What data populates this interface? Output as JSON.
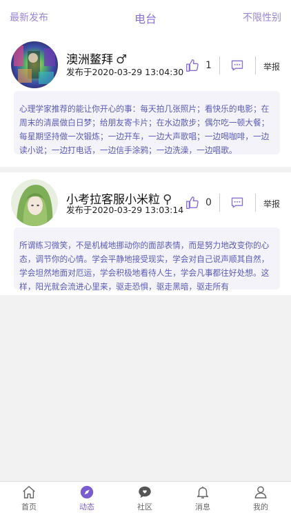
{
  "header": {
    "left_label": "最新发布",
    "title": "电台",
    "right_label": "不限性别"
  },
  "posts": [
    {
      "username": "澳洲鳌拜",
      "gender_symbol": "♂",
      "time": "发布于2020-03-29 13:04:30",
      "likes": "1",
      "report_label": "举报",
      "content": "心理学家推荐的能让你开心的事：每天拍几张照片；看快乐的电影；在周末的清晨做白日梦；给朋友寄卡片；在水边散步；偶尔吃一顿大餐；每星期坚持做一次锻炼；一边开车，一边大声歌唱；一边喝咖啡，一边读小说；一边打电话，一边信手涂鸦；一边洗澡，一边唱歌。"
    },
    {
      "username": "小考拉客服小米粒",
      "gender_symbol": "⚲",
      "time": "发布于2020-03-29 13:03:14",
      "likes": "0",
      "report_label": "举报",
      "content": "所谓练习微笑，不是机械地挪动你的面部表情，而是努力地改变你的心态，调节你的心情。学会平静地接受现实，学会对自己说声顺其自然，学会坦然地面对厄运，学会积极地看待人生，学会凡事都往好处想。这样，阳光就会流进心里来，驱走恐惧，驱走黑暗，驱走所有"
    }
  ],
  "tabs": [
    {
      "label": "首页",
      "icon": "home-icon"
    },
    {
      "label": "动态",
      "icon": "compass-icon"
    },
    {
      "label": "社区",
      "icon": "chat-bubble-icon"
    },
    {
      "label": "消息",
      "icon": "bell-icon"
    },
    {
      "label": "我的",
      "icon": "user-icon"
    }
  ],
  "colors": {
    "accent": "#8a6fd3",
    "content_text": "#5a5cb8",
    "content_bg": "#f5f3fa"
  }
}
